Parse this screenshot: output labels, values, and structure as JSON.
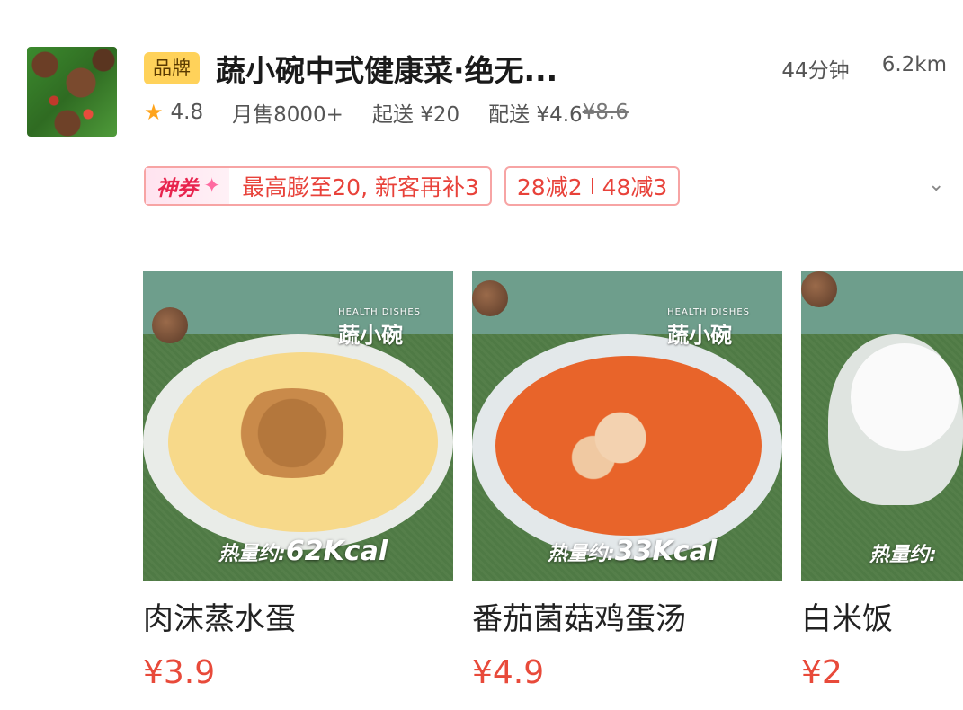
{
  "shop": {
    "badge": "品牌",
    "name": "蔬小碗中式健康菜·绝无...",
    "time": "44分钟",
    "distance": "6.2km",
    "rating": "4.8",
    "monthly_sales": "月售8000+",
    "min_order": "起送 ¥20",
    "delivery_fee": "配送 ¥4.6",
    "delivery_fee_original": "¥8.6"
  },
  "promos": {
    "coupon_tag": "神券",
    "coupon_text": "最高膨至20, 新客再补3",
    "discount1": "28减2",
    "discount2": "48减3"
  },
  "dishes": [
    {
      "name": "肉沫蒸水蛋",
      "price": "¥3.9",
      "kcal_label": "热量约:",
      "kcal": "62Kcal"
    },
    {
      "name": "番茄菌菇鸡蛋汤",
      "price": "¥4.9",
      "kcal_label": "热量约:",
      "kcal": "33Kcal"
    },
    {
      "name": "白米饭",
      "price": "¥2",
      "kcal_label": "热量约:",
      "kcal": ""
    }
  ],
  "brand_overlay": {
    "title": "蔬小碗",
    "sub": "HEALTH DISHES"
  },
  "colors": {
    "accent": "#e84a3a",
    "badge": "#ffd25a",
    "star": "#ffa41b"
  },
  "icons": {
    "rating": "star-icon",
    "expand": "chevron-down-icon"
  }
}
